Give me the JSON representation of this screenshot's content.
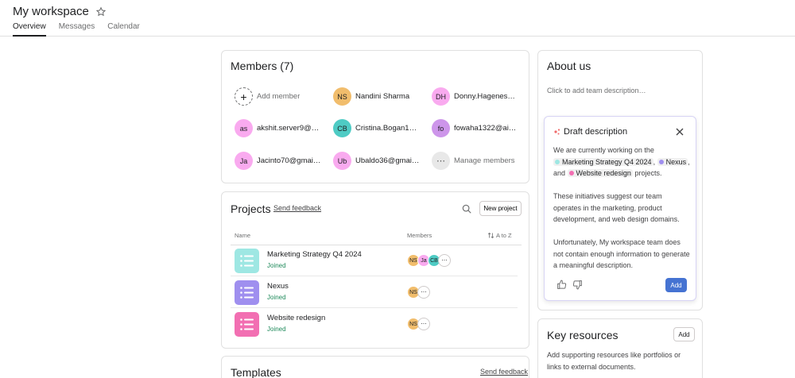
{
  "header": {
    "title": "My workspace",
    "tabs": [
      {
        "label": "Overview",
        "active": true
      },
      {
        "label": "Messages",
        "active": false
      },
      {
        "label": "Calendar",
        "active": false
      }
    ]
  },
  "members": {
    "title": "Members (7)",
    "add_label": "Add member",
    "manage_label": "Manage members",
    "manage_glyph": "⋯",
    "add_glyph": "+",
    "list": [
      {
        "initials": "NS",
        "name": "Nandini Sharma",
        "color": "#f1bd6c"
      },
      {
        "initials": "DH",
        "name": "Donny.Hagenes…",
        "color": "#f9aaef"
      },
      {
        "initials": "as",
        "name": "akshit.server9@…",
        "color": "#f9aaef"
      },
      {
        "initials": "CB",
        "name": "Cristina.Bogan1…",
        "color": "#4ecbc4"
      },
      {
        "initials": "fo",
        "name": "fowaha1322@ai…",
        "color": "#cd95ea"
      },
      {
        "initials": "Ja",
        "name": "Jacinto70@gmai…",
        "color": "#f9aaef"
      },
      {
        "initials": "Ub",
        "name": "Ubaldo36@gmai…",
        "color": "#f9aaef"
      }
    ]
  },
  "projects": {
    "title": "Projects",
    "feedback": "Send feedback",
    "new_label": "New project",
    "col_name": "Name",
    "col_members": "Members",
    "sort_label": "A to Z",
    "more_glyph": "⋯",
    "rows": [
      {
        "name": "Marketing Strategy Q4 2024",
        "status": "Joined",
        "color": "#9ee7e3",
        "members": [
          {
            "i": "NS",
            "c": "#f1bd6c"
          },
          {
            "i": "Ja",
            "c": "#f9aaef"
          },
          {
            "i": "CB",
            "c": "#4ecbc4"
          }
        ]
      },
      {
        "name": "Nexus",
        "status": "Joined",
        "color": "#9f8fef",
        "members": [
          {
            "i": "NS",
            "c": "#f1bd6c"
          }
        ]
      },
      {
        "name": "Website redesign",
        "status": "Joined",
        "color": "#f26fb2",
        "members": [
          {
            "i": "NS",
            "c": "#f1bd6c"
          }
        ]
      }
    ]
  },
  "templates": {
    "title": "Templates",
    "feedback": "Send feedback"
  },
  "about": {
    "title": "About us",
    "hint": "Click to add team description…",
    "draft": {
      "title": "Draft description",
      "p1_a": "We are currently working on the",
      "p1_b": ",",
      "p1_c": ", and",
      "p1_d": "projects.",
      "proj1": "Marketing Strategy Q4 2024",
      "proj2": "Nexus",
      "proj3": "Website redesign",
      "p2": "These initiatives suggest our team operates in the marketing, product development, and web design domains.",
      "p3": "Unfortunately, My workspace team does not contain enough information to generate a meaningful description.",
      "add_label": "Add"
    }
  },
  "key_resources": {
    "title": "Key resources",
    "add_label": "Add",
    "desc": "Add supporting resources like portfolios or links to external documents."
  }
}
